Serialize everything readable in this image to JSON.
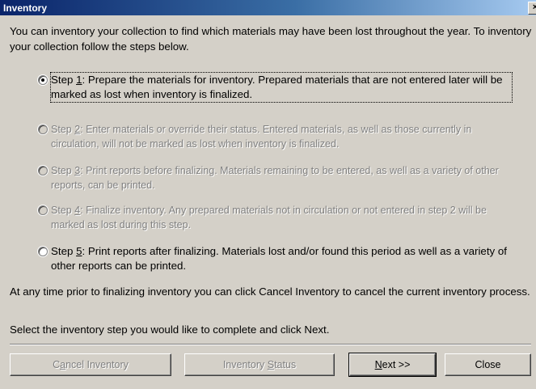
{
  "window": {
    "title": "Inventory",
    "close_glyph": "×"
  },
  "intro": "You can inventory your collection to find which materials may have been lost throughout the year. To inventory your collection follow the steps below.",
  "steps": [
    {
      "prefix": "Step ",
      "key": "1",
      "rest": ": Prepare the materials for inventory. Prepared materials that are not entered later will be marked as lost when inventory is finalized.",
      "selected": true,
      "enabled": true
    },
    {
      "prefix": "Step ",
      "key": "2",
      "rest": ": Enter materials or override their status. Entered materials, as well as those currently in circulation, will not be marked as lost when inventory is finalized.",
      "selected": false,
      "enabled": false
    },
    {
      "prefix": "Step ",
      "key": "3",
      "rest": ": Print reports before finalizing. Materials remaining to be entered, as well as a variety of other reports, can be printed.",
      "selected": false,
      "enabled": false
    },
    {
      "prefix": "Step ",
      "key": "4",
      "rest": ": Finalize inventory. Any prepared materials not in circulation or not entered in step 2 will be marked as lost during this step.",
      "selected": false,
      "enabled": false
    },
    {
      "prefix": "Step ",
      "key": "5",
      "rest": ": Print reports after finalizing. Materials lost and/or found this period as well as a variety of other reports can be printed.",
      "selected": false,
      "enabled": true
    }
  ],
  "note": "At any time prior to finalizing inventory you can click Cancel Inventory to cancel the current inventory process.",
  "instruction": "Select the inventory step you would like to complete and click Next.",
  "buttons": {
    "cancel": {
      "pre": "C",
      "key": "a",
      "post": "ncel Inventory"
    },
    "status": {
      "pre": "Inventory ",
      "key": "S",
      "post": "tatus"
    },
    "next": {
      "pre": "",
      "key": "N",
      "post": "ext >>"
    },
    "close": {
      "label": "Close"
    }
  }
}
